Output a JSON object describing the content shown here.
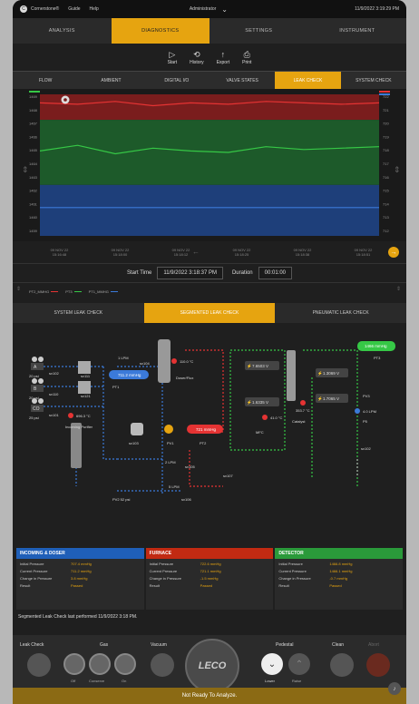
{
  "topbar": {
    "brand": "Cornerstone®",
    "guide": "Guide",
    "help": "Help",
    "user": "Administrator",
    "datetime": "11/9/2022 3:19:29 PM"
  },
  "main_tabs": [
    "ANALYSIS",
    "DIAGNOSTICS",
    "SETTINGS",
    "INSTRUMENT"
  ],
  "main_tab_active": "DIAGNOSTICS",
  "toolbar": {
    "start": "Start",
    "history": "History",
    "export": "Export",
    "print": "Print"
  },
  "sub_tabs": [
    "FLOW",
    "AMBIENT",
    "DIGITAL I/O",
    "VALVE STATES",
    "LEAK CHECK",
    "SYSTEM CHECK"
  ],
  "sub_tab_active": "LEAK CHECK",
  "chart": {
    "x_ticks": [
      "09 NOV 22\n15:16:48",
      "09 NOV 22\n15:18:00",
      "09 NOV 22\n15:18:12",
      "09 NOV 22\n15:18:25",
      "09 NOV 22\n15:18:38",
      "09 NOV 22\n15:18:51"
    ]
  },
  "chart_data": {
    "type": "line",
    "y_left_ticks": [
      1469,
      1468,
      1467,
      1466,
      1465,
      1464,
      1463,
      1462,
      1461,
      1460,
      1459
    ],
    "y_right_ticks": [
      722,
      721,
      720,
      719,
      718,
      717,
      716,
      715,
      714,
      713,
      712
    ],
    "series": [
      {
        "name": "PT2_MMHG",
        "color": "#e53333",
        "values": [
          1468.4,
          1468.3,
          1468.5,
          1468.2,
          1468.4,
          1468.3,
          1468.5,
          1468.4,
          1468.3,
          1468.4
        ]
      },
      {
        "name": "PT3",
        "color": "#36c846",
        "values": [
          1465.0,
          1465.4,
          1464.8,
          1465.2,
          1465.0,
          1464.9,
          1465.3,
          1465.1,
          1465.2,
          1465.3
        ]
      },
      {
        "name": "PT1_MMHG",
        "color": "#3b7ad9",
        "values": [
          1461.0,
          1461.0,
          1461.0,
          1461.0,
          1461.0,
          1461.0,
          1461.0,
          1461.0,
          1461.0,
          1461.0
        ]
      }
    ]
  },
  "time": {
    "start_label": "Start Time",
    "start_value": "11/9/2022 3:18:37 PM",
    "duration_label": "Duration",
    "duration_value": "00:01:00"
  },
  "legend": [
    {
      "name": "PT2_MMHG",
      "color": "#e53333"
    },
    {
      "name": "PT3",
      "color": "#36c846"
    },
    {
      "name": "PT1_MMHG",
      "color": "#3b7ad9"
    }
  ],
  "leak_tabs": [
    "SYSTEM LEAK CHECK",
    "SEGMENTED LEAK CHECK",
    "PNEUMATIC LEAK CHECK"
  ],
  "leak_tab_active": "SEGMENTED LEAK CHECK",
  "diagram": {
    "pt1": "711.2 mmHg",
    "pt2": "721 mmHg",
    "pt3": "1466 mmHg",
    "temp_furnace": "110.0 °C",
    "temp_purifier": "696.3 °C",
    "temp_mid": "41.0 °C",
    "temp_catalyst": "353.7 °C",
    "v1": "7.6503 V",
    "v2": "1.6335 V",
    "v3": "1.3069 V",
    "v4": "1.7065 V",
    "flow1": "1 LPM",
    "flow2": "2 LPM",
    "flow3": "4.0 LPM",
    "flow4": "5 LPM",
    "lbl_doser": "Doser/Flux",
    "lbl_catalyst": "Catalyst",
    "lbl_purifier": "Incoming Purifier",
    "lbl_pt1": "PT1",
    "lbl_pt2": "PT2",
    "lbl_pt3": "PT3",
    "lbl_pv1": "PV1",
    "lbl_pv2": "PV2",
    "lbl_pv3": "PV3",
    "lbl_pv2_psi": "PV2  52 psi",
    "lbl_p5": "P5",
    "lbl_mfc": "MFC",
    "psi1": "20 psi",
    "psi2": "20 psi",
    "psi3": "25 psi",
    "sv": [
      "sv102",
      "sv110",
      "sv111",
      "sv121",
      "sv101",
      "sv104",
      "sv103",
      "sv105",
      "sv106",
      "sv107",
      "sv102"
    ],
    "valve_labels": [
      "A",
      "B",
      "CO"
    ]
  },
  "panels": [
    {
      "title": "INCOMING & DOSER",
      "color": "#1f5fb8",
      "rows": [
        {
          "k": "Initial Pressure",
          "v": "707.4 mmHg"
        },
        {
          "k": "Current Pressure",
          "v": "711.2 mmHg"
        },
        {
          "k": "Change in Pressure",
          "v": "3.8 mmHg"
        },
        {
          "k": "Result",
          "v": "Passed"
        }
      ]
    },
    {
      "title": "FURNACE",
      "color": "#c22a12",
      "rows": [
        {
          "k": "Initial Pressure",
          "v": "722.6 mmHg"
        },
        {
          "k": "Current Pressure",
          "v": "721.1 mmHg"
        },
        {
          "k": "Change in Pressure",
          "v": "-1.5 mmHg"
        },
        {
          "k": "Result",
          "v": "Passed"
        }
      ]
    },
    {
      "title": "DETECTOR",
      "color": "#2a9a3a",
      "rows": [
        {
          "k": "Initial Pressure",
          "v": "1466.8 mmHg"
        },
        {
          "k": "Current Pressure",
          "v": "1466.1 mmHg"
        },
        {
          "k": "Change in Pressure",
          "v": "-0.7 mmHg"
        },
        {
          "k": "Result",
          "v": "Passed"
        }
      ]
    }
  ],
  "last_performed": "Segmented Leak Check last performed 11/9/2022 3:18 PM.",
  "controls": {
    "leak_check": "Leak Check",
    "gas": "Gas",
    "off": "Off",
    "conserve": "Conserve",
    "on": "On",
    "vacuum": "Vacuum",
    "logo": "LECO",
    "pedestal": "Pedestal",
    "lower": "Lower",
    "raise": "Raise",
    "clean": "Clean",
    "abort": "Abort"
  },
  "status": "Not Ready To Analyze."
}
